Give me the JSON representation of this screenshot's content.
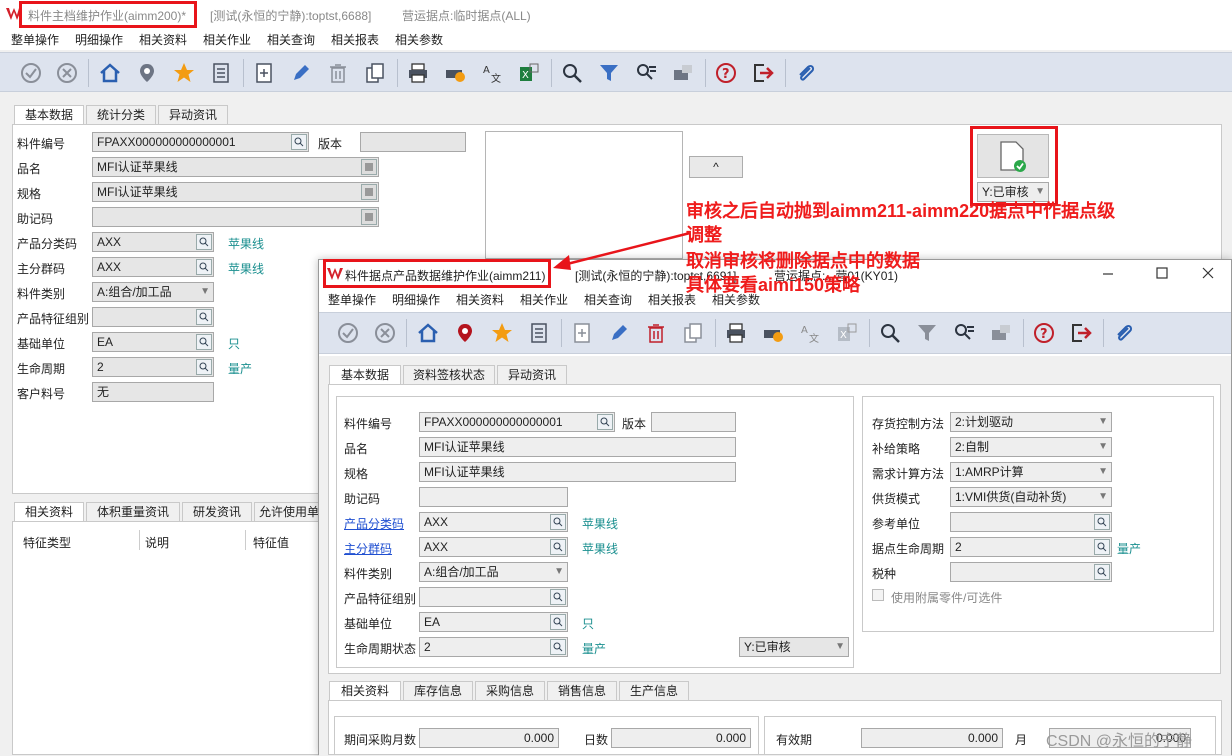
{
  "back_window": {
    "title": "料件主档维护作业(aimm200)*",
    "subtitle": "[测试(永恒的宁静):toptst,6688]",
    "site": "营运据点:临时据点(ALL)",
    "menu": [
      "整单操作",
      "明细操作",
      "相关资料",
      "相关作业",
      "相关查询",
      "相关报表",
      "相关参数"
    ],
    "tabs": [
      "基本数据",
      "统计分类",
      "异动资讯"
    ],
    "fields": {
      "item_no_label": "料件编号",
      "item_no": "FPAXX000000000000001",
      "version_label": "版本",
      "version": "",
      "name_label": "品名",
      "name": "MFI认证苹果线",
      "spec_label": "规格",
      "spec": "MFI认证苹果线",
      "memo_label": "助记码",
      "memo": "",
      "category_label": "产品分类码",
      "category": "AXX",
      "category_desc": "苹果线",
      "group_label": "主分群码",
      "group": "AXX",
      "group_desc": "苹果线",
      "type_label": "料件类别",
      "type": "A:组合/加工品",
      "feature_label": "产品特征组别",
      "feature": "",
      "unit_label": "基础单位",
      "unit": "EA",
      "unit_desc": "只",
      "life_label": "生命周期",
      "life": "2",
      "life_desc": "量产",
      "customer_label": "客户料号",
      "customer": "无"
    },
    "up_button": "^",
    "status_label": "Y:已审核",
    "bottom_tabs": [
      "相关资料",
      "体积重量资讯",
      "研发资讯",
      "允许使用单"
    ],
    "grid_headers": [
      "特征类型",
      "说明",
      "特征值"
    ]
  },
  "annotation": {
    "line1": "审核之后自动抛到aimm211-aimm220据点中作据点级",
    "line2": "调整",
    "line3": "取消审核将删除据点中的数据",
    "line4": "具体要看aimi150策略"
  },
  "front_window": {
    "title": "料件据点产品数据维护作业(aimm211)",
    "subtitle": "[测试(永恒的宁静):toptst,6691]",
    "site": "营运据点:...营01(KY01)",
    "menu": [
      "整单操作",
      "明细操作",
      "相关资料",
      "相关作业",
      "相关查询",
      "相关报表",
      "相关参数"
    ],
    "tabs": [
      "基本数据",
      "资料签核状态",
      "异动资讯"
    ],
    "left": {
      "item_no_label": "料件编号",
      "item_no": "FPAXX000000000000001",
      "version_label": "版本",
      "version": "",
      "name_label": "品名",
      "name": "MFI认证苹果线",
      "spec_label": "规格",
      "spec": "MFI认证苹果线",
      "memo_label": "助记码",
      "memo": "",
      "category_label": "产品分类码",
      "category": "AXX",
      "category_desc": "苹果线",
      "group_label": "主分群码",
      "group": "AXX",
      "group_desc": "苹果线",
      "type_label": "料件类别",
      "type": "A:组合/加工品",
      "feature_label": "产品特征组别",
      "feature": "",
      "unit_label": "基础单位",
      "unit": "EA",
      "unit_desc": "只",
      "life_label": "生命周期状态",
      "life": "2",
      "life_desc": "量产",
      "status": "Y:已审核"
    },
    "right": {
      "inv_label": "存货控制方法",
      "inv": "2:计划驱动",
      "replen_label": "补给策略",
      "replen": "2:自制",
      "demand_label": "需求计算方法",
      "demand": "1:AMRP计算",
      "supply_label": "供货模式",
      "supply": "1:VMI供货(自动补货)",
      "ref_unit_label": "参考单位",
      "ref_unit": "",
      "site_life_label": "据点生命周期",
      "site_life": "2",
      "site_life_desc": "量产",
      "tax_label": "税种",
      "tax": "",
      "optional_label": "使用附属零件/可选件"
    },
    "bottom_tabs": [
      "相关资料",
      "库存信息",
      "采购信息",
      "销售信息",
      "生产信息"
    ],
    "bottom": {
      "purchase_months_label": "期间采购月数",
      "purchase_months": "0.000",
      "days_label": "日数",
      "days": "0.000",
      "valid_label": "有效期",
      "valid": "0.000",
      "month_label": "月",
      "valid2": "0.000"
    }
  },
  "watermark": "CSDN @永恒的宁静",
  "colors": {
    "highlight": "#e8141a",
    "teal": "#1a8f8f",
    "toolbar": "#dde3ee"
  }
}
